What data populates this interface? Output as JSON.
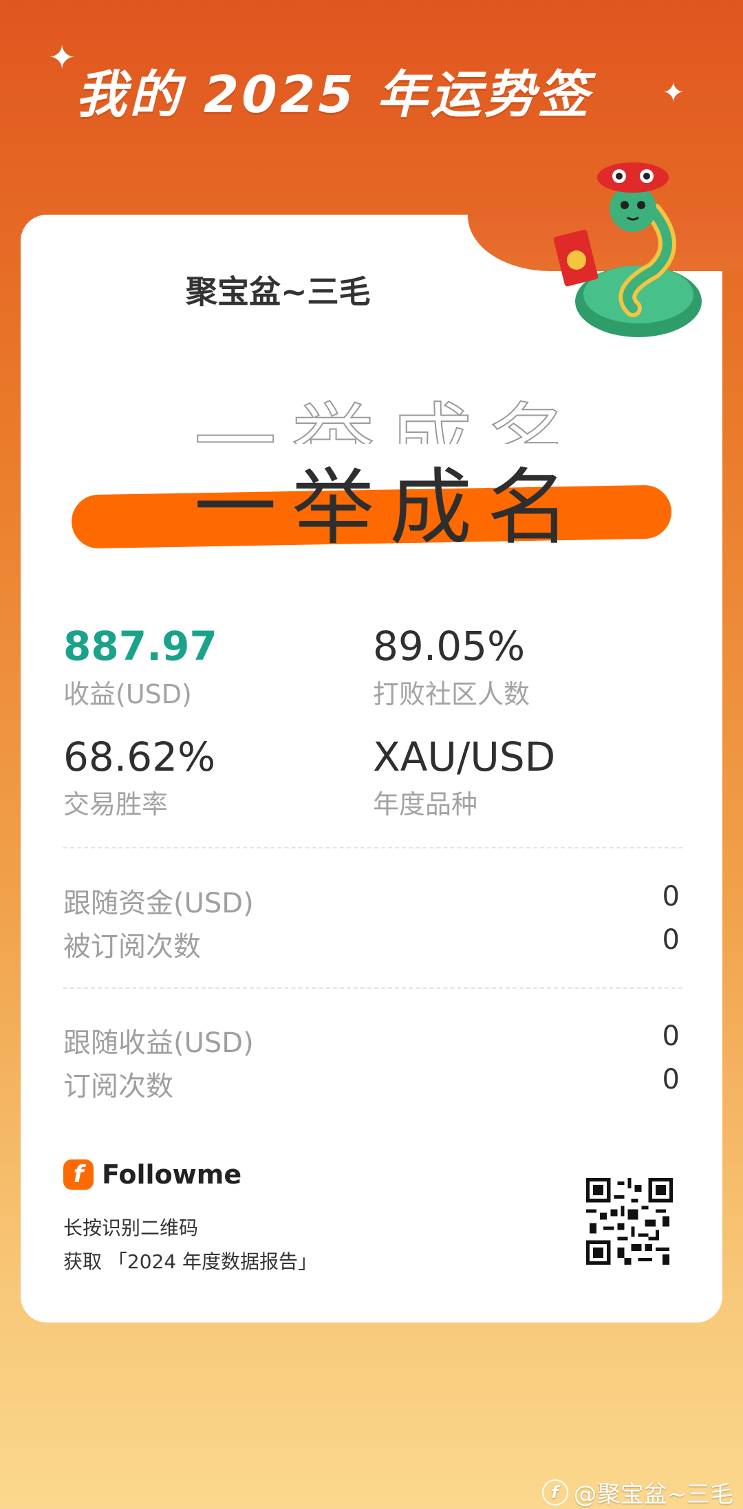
{
  "header": {
    "title": "我的 2025 年运势签"
  },
  "card": {
    "user_name": "聚宝盆~三毛",
    "slogan": "一举成名",
    "stats": [
      {
        "value": "887.97",
        "label": "收益(USD)",
        "accent": "#1aa38a"
      },
      {
        "value": "89.05%",
        "label": "打败社区人数"
      },
      {
        "value": "68.62%",
        "label": "交易胜率"
      },
      {
        "value": "XAU/USD",
        "label": "年度品种"
      }
    ],
    "group1": [
      {
        "label": "跟随资金(USD)",
        "value": "0"
      },
      {
        "label": "被订阅次数",
        "value": "0"
      }
    ],
    "group2": [
      {
        "label": "跟随收益(USD)",
        "value": "0"
      },
      {
        "label": "订阅次数",
        "value": "0"
      }
    ],
    "footer": {
      "brand": "Followme",
      "brand_logo_letter": "f",
      "line1": "长按识别二维码",
      "line2": "获取 「2024 年度数据报告」"
    }
  },
  "watermark": {
    "logo_letter": "f",
    "text": "@聚宝盆~三毛"
  },
  "colors": {
    "accent": "#ff6a00",
    "positive": "#1aa38a"
  }
}
